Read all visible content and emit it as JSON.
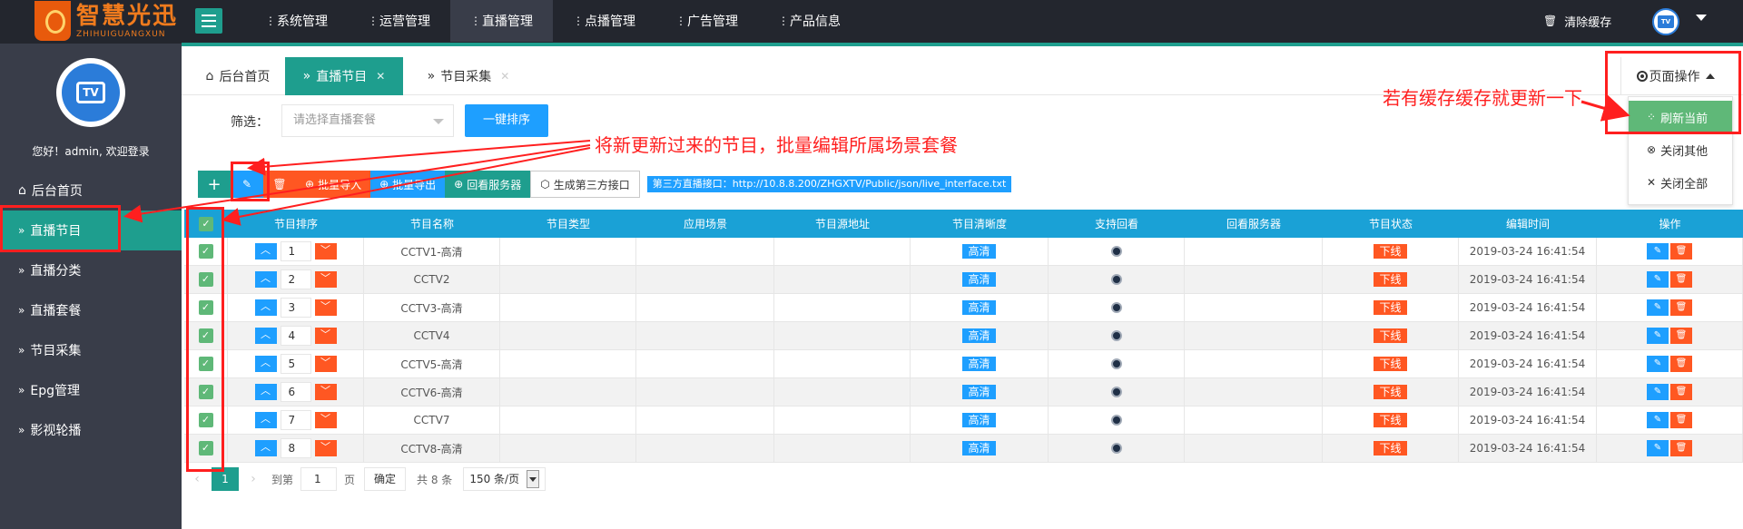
{
  "brand": {
    "name_cn": "智慧光迅",
    "name_en": "ZHIHUIGUANGXUN"
  },
  "topnav": {
    "items": [
      "系统管理",
      "运营管理",
      "直播管理",
      "点播管理",
      "广告管理",
      "产品信息"
    ],
    "active_index": 2,
    "clear_cache": "清除缓存",
    "avatar_text": "TV"
  },
  "sidebar": {
    "avatar_text": "TV",
    "greeting": "您好！admin, 欢迎登录",
    "items": [
      "后台首页",
      "直播节目",
      "直播分类",
      "直播套餐",
      "节目采集",
      "Epg管理",
      "影视轮播"
    ],
    "active_index": 1
  },
  "tabs": {
    "home": "后台首页",
    "items": [
      "直播节目",
      "节目采集"
    ],
    "close": "✕",
    "page_op": "页面操作"
  },
  "dropdown": {
    "items": [
      "刷新当前",
      "关闭其他",
      "关闭全部"
    ]
  },
  "filter": {
    "label": "筛选：",
    "placeholder": "请选择直播套餐",
    "sort_button": "一键排序"
  },
  "toolbar": {
    "add": "+",
    "import": "批量导入",
    "export": "批量导出",
    "server": "回看服务器",
    "generate": "生成第三方接口",
    "info": "第三方直播接口：http://10.8.8.200/ZHGXTV/Public/json/live_interface.txt"
  },
  "table": {
    "headers": [
      "",
      "节目排序",
      "节目名称",
      "节目类型",
      "应用场景",
      "节目源地址",
      "节目清晰度",
      "支持回看",
      "回看服务器",
      "节目状态",
      "编辑时间",
      "操作"
    ],
    "rows": [
      {
        "order": "1",
        "name": "CCTV1-高清",
        "quality": "高清",
        "status": "下线",
        "time": "2019-03-24 16:41:54"
      },
      {
        "order": "2",
        "name": "CCTV2",
        "quality": "高清",
        "status": "下线",
        "time": "2019-03-24 16:41:54"
      },
      {
        "order": "3",
        "name": "CCTV3-高清",
        "quality": "高清",
        "status": "下线",
        "time": "2019-03-24 16:41:54"
      },
      {
        "order": "4",
        "name": "CCTV4",
        "quality": "高清",
        "status": "下线",
        "time": "2019-03-24 16:41:54"
      },
      {
        "order": "5",
        "name": "CCTV5-高清",
        "quality": "高清",
        "status": "下线",
        "time": "2019-03-24 16:41:54"
      },
      {
        "order": "6",
        "name": "CCTV6-高清",
        "quality": "高清",
        "status": "下线",
        "time": "2019-03-24 16:41:54"
      },
      {
        "order": "7",
        "name": "CCTV7",
        "quality": "高清",
        "status": "下线",
        "time": "2019-03-24 16:41:54"
      },
      {
        "order": "8",
        "name": "CCTV8-高清",
        "quality": "高清",
        "status": "下线",
        "time": "2019-03-24 16:41:54"
      }
    ]
  },
  "pager": {
    "current": "1",
    "goto": "到第",
    "page_value": "1",
    "page_unit": "页",
    "confirm": "确定",
    "total": "共 8 条",
    "page_size": "150 条/页"
  },
  "annotations": {
    "batch_edit": "将新更新过来的节目，批量编辑所属场景套餐",
    "cache": "若有缓存缓存就更新一下"
  },
  "colors": {
    "accent": "#1e9e8e",
    "blue": "#1e9fff",
    "orange": "#ff5722",
    "annotation": "#ff1f1f",
    "topbar": "#23262e",
    "sidebar": "#393d49"
  }
}
